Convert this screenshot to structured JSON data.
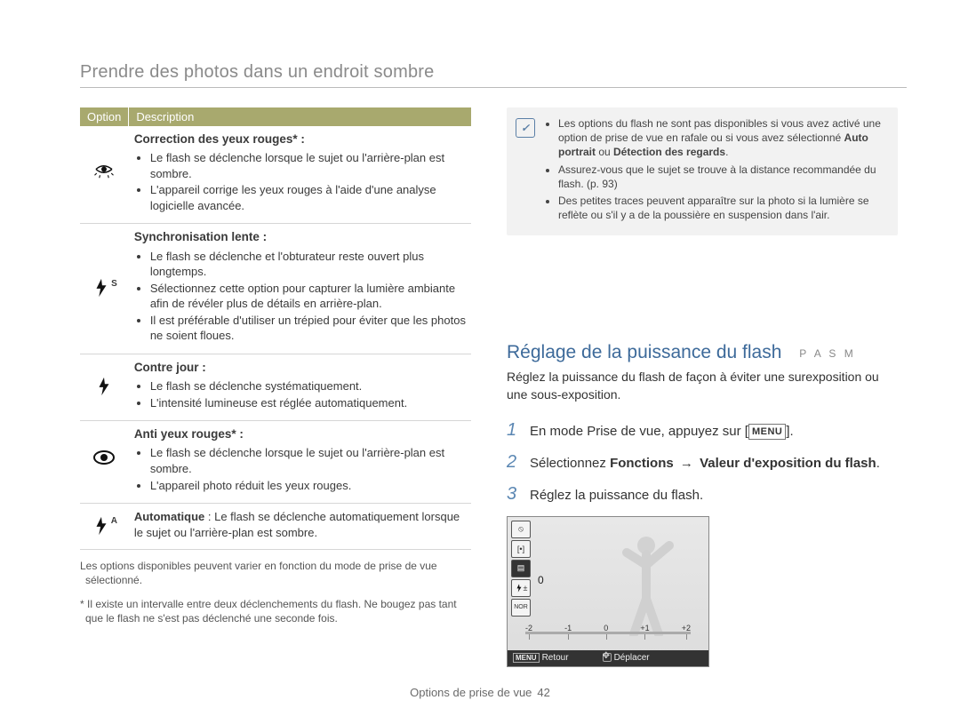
{
  "page_title": "Prendre des photos dans un endroit sombre",
  "header": {
    "option": "Option",
    "description": "Description"
  },
  "rows": [
    {
      "icon": "eye-wink-icon",
      "title": "Correction des yeux rouges* :",
      "bullets": [
        "Le flash se déclenche lorsque le sujet ou l'arrière-plan est sombre.",
        "L'appareil corrige les yeux rouges à l'aide d'une analyse logicielle avancée."
      ]
    },
    {
      "icon": "flash-s-icon",
      "title": "Synchronisation lente :",
      "bullets": [
        "Le flash se déclenche et l'obturateur reste ouvert plus longtemps.",
        "Sélectionnez cette option pour capturer la lumière ambiante afin de révéler plus de détails en arrière-plan.",
        "Il est préférable d'utiliser un trépied pour éviter que les photos ne soient floues."
      ]
    },
    {
      "icon": "flash-icon",
      "title": "Contre jour :",
      "bullets": [
        "Le flash se déclenche systématiquement.",
        "L'intensité lumineuse est réglée automatiquement."
      ]
    },
    {
      "icon": "eye-icon",
      "title": "Anti yeux rouges* :",
      "bullets": [
        "Le flash se déclenche lorsque le sujet ou l'arrière-plan est sombre.",
        "L'appareil photo réduit les yeux rouges."
      ]
    },
    {
      "icon": "flash-a-icon",
      "inline_label": "Automatique",
      "inline_text": " : Le flash se déclenche automatiquement lorsque le sujet ou l'arrière-plan est sombre."
    }
  ],
  "footnotes": {
    "f1": "Les options disponibles peuvent varier en fonction du mode de prise de vue sélectionné.",
    "f2": "* Il existe un intervalle entre deux déclenchements du flash. Ne bougez pas tant que le flash ne s'est pas déclenché une seconde fois."
  },
  "note": {
    "items": [
      {
        "text_pre": "Les options du flash ne sont pas disponibles si vous avez activé une option de prise de vue en rafale ou si vous avez sélectionné ",
        "bold1": "Auto portrait",
        "mid": " ou ",
        "bold2": "Détection des regards",
        "text_post": "."
      },
      {
        "text": "Assurez-vous que le sujet se trouve à la distance recommandée du flash. (p. 93)"
      },
      {
        "text": "Des petites traces peuvent apparaître sur la photo si la lumière se reflète ou s'il y a de la poussière en suspension dans l'air."
      }
    ]
  },
  "section": {
    "heading": "Réglage de la puissance du flash",
    "modes": "P A S M",
    "paragraph": "Réglez la puissance du flash de façon à éviter une surexposition ou une sous-exposition."
  },
  "steps": {
    "s1_pre": "En mode Prise de vue, appuyez sur [",
    "s1_label": "MENU",
    "s1_post": "].",
    "s2_pre": "Sélectionnez ",
    "s2_b1": "Fonctions",
    "s2_arrow": "→",
    "s2_b2": "Valeur d'exposition du flash",
    "s2_post": ".",
    "s3": "Réglez la puissance du flash."
  },
  "lcd": {
    "value": "0",
    "ticks": [
      "-2",
      "-1",
      "0",
      "+1",
      "+2"
    ],
    "footer_left_key": "MENU",
    "footer_left": "Retour",
    "footer_right": "Déplacer",
    "side_icons": [
      "off",
      "focus",
      "meter",
      "ev",
      "nor"
    ]
  },
  "page_footer": {
    "label": "Options de prise de vue",
    "num": "42"
  }
}
